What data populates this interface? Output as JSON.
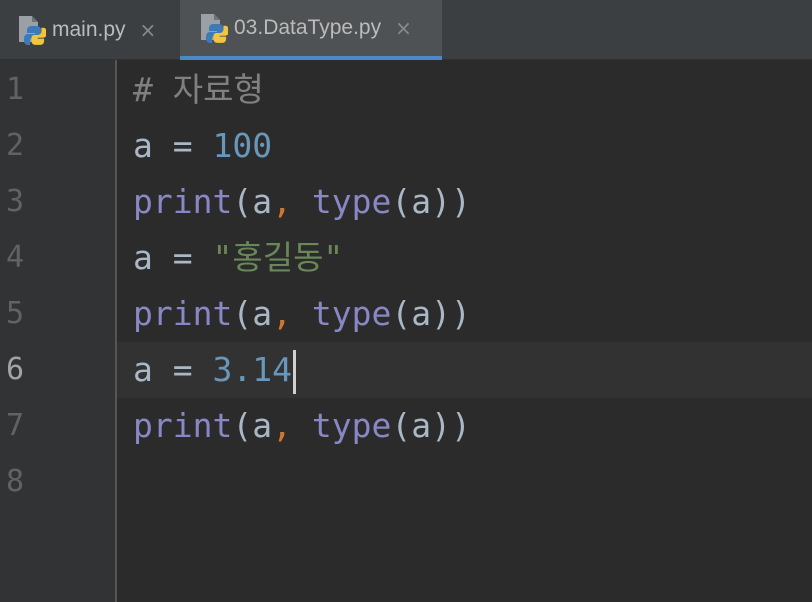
{
  "tabs": [
    {
      "label": "main.py",
      "icon": "python-file-icon",
      "active": false
    },
    {
      "label": "03.DataType.py",
      "icon": "python-file-icon",
      "active": true
    }
  ],
  "close_glyph": "×",
  "gutter": {
    "line_numbers": [
      "1",
      "2",
      "3",
      "4",
      "5",
      "6",
      "7",
      "8"
    ],
    "current_line": "6"
  },
  "code": {
    "comment": "# 자료형",
    "var": "a",
    "assign": " = ",
    "num_100": "100",
    "print": "print",
    "open_paren": "(",
    "comma": ",",
    "space": " ",
    "type": "type",
    "close_paren": ")",
    "str_gildong": "\"홍길동\"",
    "num_314": "3.14"
  },
  "colors": {
    "background": "#2b2b2b",
    "gutter_bg": "#313335",
    "tab_bar_bg": "#3c3f41",
    "active_tab_accent": "#4a88c7",
    "comment": "#808080",
    "number": "#6897bb",
    "string": "#6a8759",
    "builtin": "#8888c6",
    "comma": "#cc7832",
    "identifier": "#a9b7c6"
  }
}
